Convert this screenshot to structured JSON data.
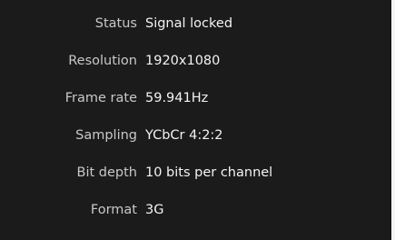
{
  "properties": [
    {
      "label": "Status",
      "value": "Signal locked"
    },
    {
      "label": "Resolution",
      "value": "1920x1080"
    },
    {
      "label": "Frame rate",
      "value": "59.941Hz"
    },
    {
      "label": "Sampling",
      "value": "YCbCr 4:2:2"
    },
    {
      "label": "Bit depth",
      "value": "10 bits per channel"
    },
    {
      "label": "Format",
      "value": "3G"
    }
  ],
  "colors": {
    "background": "#1b1b1b",
    "label": "#c8c8c8",
    "value": "#f3f3f3"
  }
}
